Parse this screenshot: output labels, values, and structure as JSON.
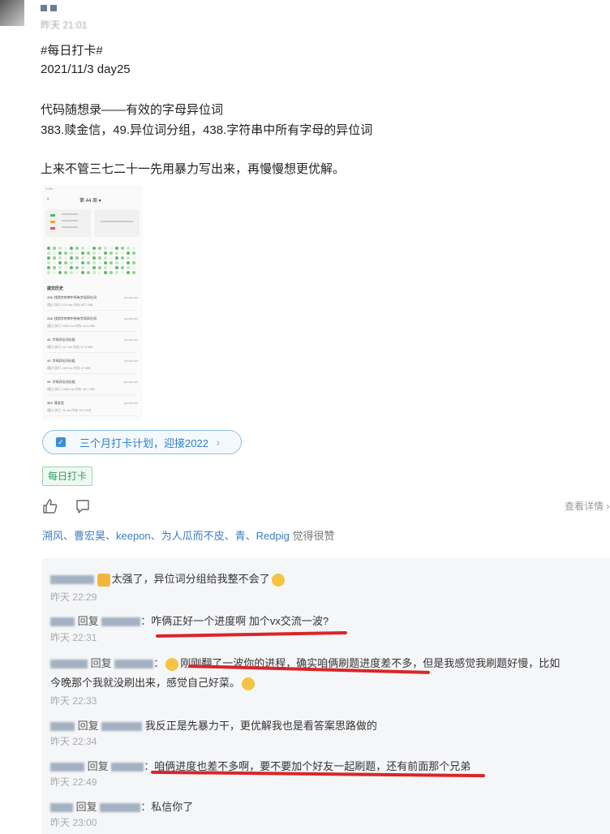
{
  "post": {
    "time": "昨天 21:01",
    "tag_line": "#每日打卡#",
    "date_line": "2021/11/3 day25",
    "title_line": "代码随想录——有效的字母异位词",
    "problems_line": "383.赎金信，49.异位词分组，438.字符串中所有字母的异位词",
    "note_line": "上来不管三七二十一先用暴力写出来，再慢慢想更优解。"
  },
  "screenshot": {
    "status": "2:08 •",
    "week": "第 44 周 ▾",
    "history_title": "提交历史",
    "rows": [
      {
        "title": "438. 找到字符串中所有字母异位词",
        "sub": "通过  执行 100 ms  内存 45.1 MB",
        "right": "javascript"
      },
      {
        "title": "438. 找到字符串中所有字母异位词",
        "sub": "通过  执行 3320 ms  内存 44.6 MB",
        "right": "javascript"
      },
      {
        "title": "49. 字母异位词分组",
        "sub": "通过  执行 112 ms  内存 47.6 MB",
        "right": "javascript"
      },
      {
        "title": "49. 字母异位词分组",
        "sub": "通过  执行 128 ms  内存 47 MB",
        "right": "javascript"
      },
      {
        "title": "49. 字母异位词分组",
        "sub": "通过  执行 1956 ms  内存 48.1 MB",
        "right": "javascript"
      },
      {
        "title": "383. 赎金信",
        "sub": "通过  执行 76 ms  内存 40.3 MB",
        "right": "javascript"
      }
    ]
  },
  "plan": {
    "label": "三个月打卡计划，迎接2022"
  },
  "tag": "每日打卡",
  "actions": {
    "detail": "查看详情 ›"
  },
  "likes": {
    "names": "溯风、曹宏昊、keepon、为人瓜而不皮、青、Redpig",
    "suffix": " 觉得很赞"
  },
  "comments": [
    {
      "reply": "",
      "text": "太强了，异位词分组给我整不会了",
      "time": "昨天 22:29"
    },
    {
      "reply": "回复",
      "text": "咋俩正好一个进度啊 加个vx交流一波?",
      "time": "昨天 22:31"
    },
    {
      "reply": "回复",
      "text": "刚刚翻了一波你的进程，确实咱俩刷题进度差不多，但是我感觉我刷题好慢，比如",
      "text2": "今晚那个我就没刷出来，感觉自己好菜。",
      "time": "昨天 22:33"
    },
    {
      "reply": "回复",
      "text": "我反正是先暴力干，更优解我也是看答案思路做的",
      "time": "昨天 22:34"
    },
    {
      "reply": "回复",
      "text": "咱俩进度也差不多啊，要不要加个好友一起刷题，还有前面那个兄弟",
      "time": "昨天 22:49"
    },
    {
      "reply": "回复",
      "text": "私信你了",
      "time": "昨天 23:00"
    }
  ],
  "colors": {
    "link": "#3d7ec0",
    "underline": "#d8262a",
    "tag_green": "#2f9a5a"
  }
}
